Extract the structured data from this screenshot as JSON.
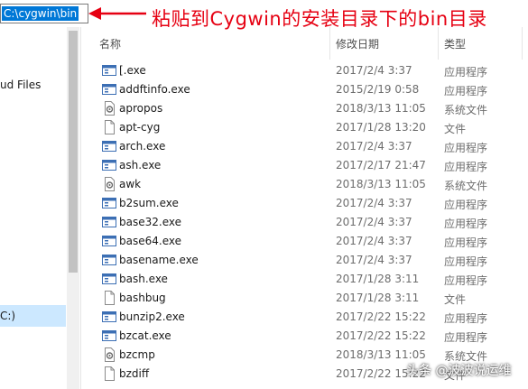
{
  "address_bar": {
    "path": "C:\\cygwin\\bin"
  },
  "annotation": {
    "text": "粘贴到Cygwin的安装目录下的bin目录"
  },
  "nav": {
    "cloud_label": "ud Files",
    "drive_label": "C:)"
  },
  "columns": {
    "name": "名称",
    "date": "修改日期",
    "type": "类型"
  },
  "files": [
    {
      "name": "[.exe",
      "date": "2017/2/4 3:37",
      "type": "应用程序",
      "icon": "exe-icon"
    },
    {
      "name": "addftinfo.exe",
      "date": "2015/2/19 0:58",
      "type": "应用程序",
      "icon": "exe-icon"
    },
    {
      "name": "apropos",
      "date": "2018/3/13 11:05",
      "type": "系统文件",
      "icon": "system-file-icon"
    },
    {
      "name": "apt-cyg",
      "date": "2017/1/28 13:20",
      "type": "文件",
      "icon": "file-icon"
    },
    {
      "name": "arch.exe",
      "date": "2017/2/4 3:37",
      "type": "应用程序",
      "icon": "exe-icon"
    },
    {
      "name": "ash.exe",
      "date": "2017/2/17 21:47",
      "type": "应用程序",
      "icon": "exe-icon"
    },
    {
      "name": "awk",
      "date": "2018/3/13 11:05",
      "type": "系统文件",
      "icon": "system-file-icon"
    },
    {
      "name": "b2sum.exe",
      "date": "2017/2/4 3:37",
      "type": "应用程序",
      "icon": "exe-icon"
    },
    {
      "name": "base32.exe",
      "date": "2017/2/4 3:37",
      "type": "应用程序",
      "icon": "exe-icon"
    },
    {
      "name": "base64.exe",
      "date": "2017/2/4 3:37",
      "type": "应用程序",
      "icon": "exe-icon"
    },
    {
      "name": "basename.exe",
      "date": "2017/2/4 3:37",
      "type": "应用程序",
      "icon": "exe-icon"
    },
    {
      "name": "bash.exe",
      "date": "2017/1/28 3:11",
      "type": "应用程序",
      "icon": "exe-icon"
    },
    {
      "name": "bashbug",
      "date": "2017/1/28 3:11",
      "type": "文件",
      "icon": "file-icon"
    },
    {
      "name": "bunzip2.exe",
      "date": "2017/2/22 15:22",
      "type": "应用程序",
      "icon": "exe-icon"
    },
    {
      "name": "bzcat.exe",
      "date": "2017/2/22 15:22",
      "type": "应用程序",
      "icon": "exe-icon"
    },
    {
      "name": "bzcmp",
      "date": "2018/3/13 11:05",
      "type": "系统文件",
      "icon": "system-file-icon"
    },
    {
      "name": "bzdiff",
      "date": "2017/2/22 15:22",
      "type": "文件",
      "icon": "file-icon"
    }
  ],
  "watermark": {
    "text": "头条 @波波说运维"
  },
  "colors": {
    "annotation": "#e60012",
    "selection": "#0078d7",
    "nav_selected": "#cce8ff"
  }
}
